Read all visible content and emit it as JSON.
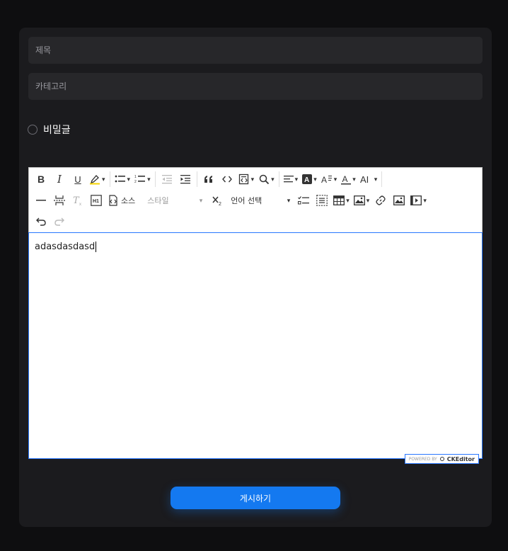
{
  "form": {
    "title_placeholder": "제목",
    "category_placeholder": "카테고리",
    "secret_label": "비밀글",
    "submit_label": "게시하기"
  },
  "editor": {
    "content": "adasdasdasd",
    "source_label": "소스",
    "style_label": "스타일",
    "language_label": "언어 선택",
    "powered_by": "POWERED BY",
    "brand": "CKEditor"
  },
  "colors": {
    "background": "#0e0e10",
    "card": "#1b1b1e",
    "field": "#27272a",
    "accent": "#1479f0",
    "focus_border": "#2977ff"
  }
}
